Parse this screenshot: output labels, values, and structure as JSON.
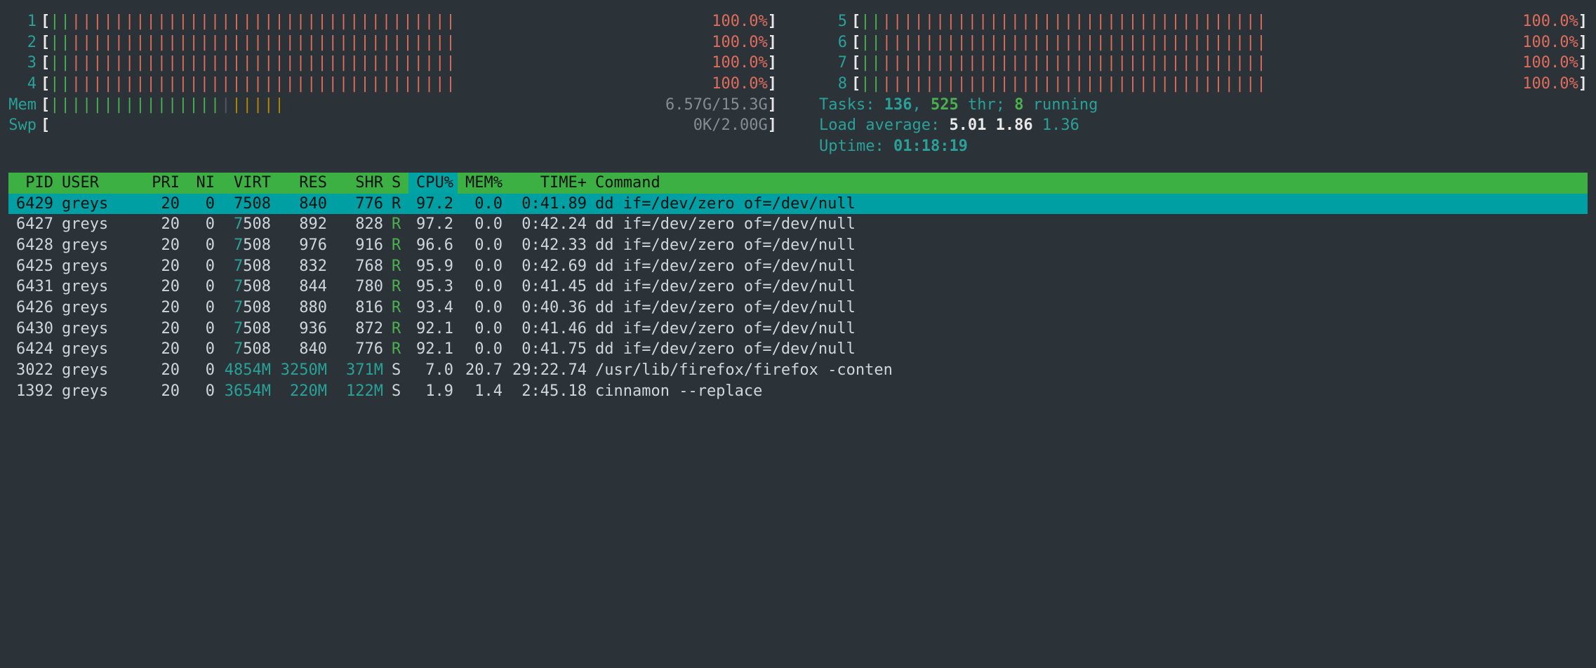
{
  "cpu_meters_left": [
    {
      "id": "1",
      "pct": "100.0%"
    },
    {
      "id": "2",
      "pct": "100.0%"
    },
    {
      "id": "3",
      "pct": "100.0%"
    },
    {
      "id": "4",
      "pct": "100.0%"
    }
  ],
  "cpu_meters_right": [
    {
      "id": "5",
      "pct": "100.0%"
    },
    {
      "id": "6",
      "pct": "100.0%"
    },
    {
      "id": "7",
      "pct": "100.0%"
    },
    {
      "id": "8",
      "pct": "100.0%"
    }
  ],
  "mem": {
    "label": "Mem",
    "value": "6.57G/15.3G"
  },
  "swp": {
    "label": "Swp",
    "value": "0K/2.00G"
  },
  "tasks": {
    "label": "Tasks: ",
    "procs": "136",
    "sep": ", ",
    "threads": "525",
    "thr_label": " thr; ",
    "running": "8",
    "run_label": " running"
  },
  "load": {
    "label": "Load average: ",
    "l1": "5.01",
    "l2": "1.86",
    "l3": "1.36"
  },
  "uptime": {
    "label": "Uptime: ",
    "value": "01:18:19"
  },
  "headers": {
    "pid": "PID",
    "user": "USER",
    "pri": "PRI",
    "ni": "NI",
    "virt": "VIRT",
    "res": "RES",
    "shr": "SHR",
    "s": "S",
    "cpu": "CPU%",
    "mem": "MEM%",
    "time": "TIME+",
    "cmd": "Command"
  },
  "processes": [
    {
      "pid": "6429",
      "user": "greys",
      "pri": "20",
      "ni": "0",
      "virt": "7508",
      "res": "840",
      "shr": "776",
      "s": "R",
      "cpu": "97.2",
      "mem": "0.0",
      "time": "0:41.89",
      "cmd": "dd if=/dev/zero of=/dev/null",
      "sel": true
    },
    {
      "pid": "6427",
      "user": "greys",
      "pri": "20",
      "ni": "0",
      "virt": "7508",
      "res": "892",
      "shr": "828",
      "s": "R",
      "cpu": "97.2",
      "mem": "0.0",
      "time": "0:42.24",
      "cmd": "dd if=/dev/zero of=/dev/null"
    },
    {
      "pid": "6428",
      "user": "greys",
      "pri": "20",
      "ni": "0",
      "virt": "7508",
      "res": "976",
      "shr": "916",
      "s": "R",
      "cpu": "96.6",
      "mem": "0.0",
      "time": "0:42.33",
      "cmd": "dd if=/dev/zero of=/dev/null"
    },
    {
      "pid": "6425",
      "user": "greys",
      "pri": "20",
      "ni": "0",
      "virt": "7508",
      "res": "832",
      "shr": "768",
      "s": "R",
      "cpu": "95.9",
      "mem": "0.0",
      "time": "0:42.69",
      "cmd": "dd if=/dev/zero of=/dev/null"
    },
    {
      "pid": "6431",
      "user": "greys",
      "pri": "20",
      "ni": "0",
      "virt": "7508",
      "res": "844",
      "shr": "780",
      "s": "R",
      "cpu": "95.3",
      "mem": "0.0",
      "time": "0:41.45",
      "cmd": "dd if=/dev/zero of=/dev/null"
    },
    {
      "pid": "6426",
      "user": "greys",
      "pri": "20",
      "ni": "0",
      "virt": "7508",
      "res": "880",
      "shr": "816",
      "s": "R",
      "cpu": "93.4",
      "mem": "0.0",
      "time": "0:40.36",
      "cmd": "dd if=/dev/zero of=/dev/null"
    },
    {
      "pid": "6430",
      "user": "greys",
      "pri": "20",
      "ni": "0",
      "virt": "7508",
      "res": "936",
      "shr": "872",
      "s": "R",
      "cpu": "92.1",
      "mem": "0.0",
      "time": "0:41.46",
      "cmd": "dd if=/dev/zero of=/dev/null"
    },
    {
      "pid": "6424",
      "user": "greys",
      "pri": "20",
      "ni": "0",
      "virt": "7508",
      "res": "840",
      "shr": "776",
      "s": "R",
      "cpu": "92.1",
      "mem": "0.0",
      "time": "0:41.75",
      "cmd": "dd if=/dev/zero of=/dev/null"
    },
    {
      "pid": "3022",
      "user": "greys",
      "pri": "20",
      "ni": "0",
      "virt": "4854M",
      "res": "3250M",
      "shr": "371M",
      "s": "S",
      "cpu": "7.0",
      "mem": "20.7",
      "time": "29:22.74",
      "cmd": "/usr/lib/firefox/firefox -conten",
      "bigmem": true
    },
    {
      "pid": "1392",
      "user": "greys",
      "pri": "20",
      "ni": "0",
      "virt": "3654M",
      "res": "220M",
      "shr": "122M",
      "s": "S",
      "cpu": "1.9",
      "mem": "1.4",
      "time": "2:45.18",
      "cmd": "cinnamon --replace",
      "bigmem": true
    }
  ]
}
